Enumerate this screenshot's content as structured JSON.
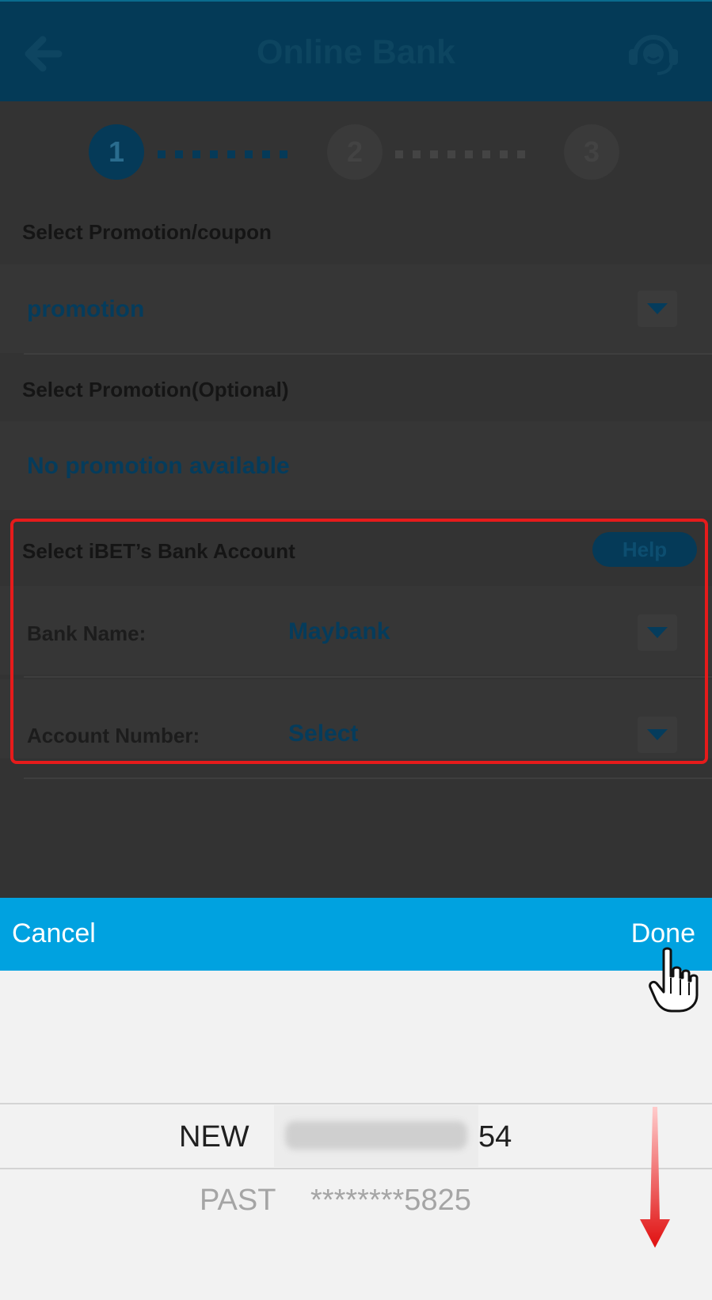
{
  "header": {
    "title": "Online Bank",
    "back_icon": "arrow-left-icon",
    "support_icon": "headset-icon"
  },
  "steps": [
    "1",
    "2",
    "3"
  ],
  "promotion_coupon": {
    "label": "Select Promotion/coupon",
    "value": "promotion"
  },
  "promotion_optional": {
    "label": "Select Promotion(Optional)",
    "value": "No promotion available"
  },
  "bank_account": {
    "label": "Select iBET’s Bank Account",
    "help_label": "Help",
    "bank_name_label": "Bank Name:",
    "bank_name_value": "Maybank",
    "account_number_label": "Account Number:",
    "account_number_value": "Select"
  },
  "toolbar": {
    "cancel_label": "Cancel",
    "done_label": "Done"
  },
  "picker": {
    "rows": [
      {
        "type": "NEW",
        "account_visible_suffix": "54"
      },
      {
        "type": "PAST",
        "account": "********5825"
      }
    ]
  },
  "colors": {
    "accent": "#00a2e0",
    "header": "#043a57",
    "highlight": "#e61b1b"
  }
}
